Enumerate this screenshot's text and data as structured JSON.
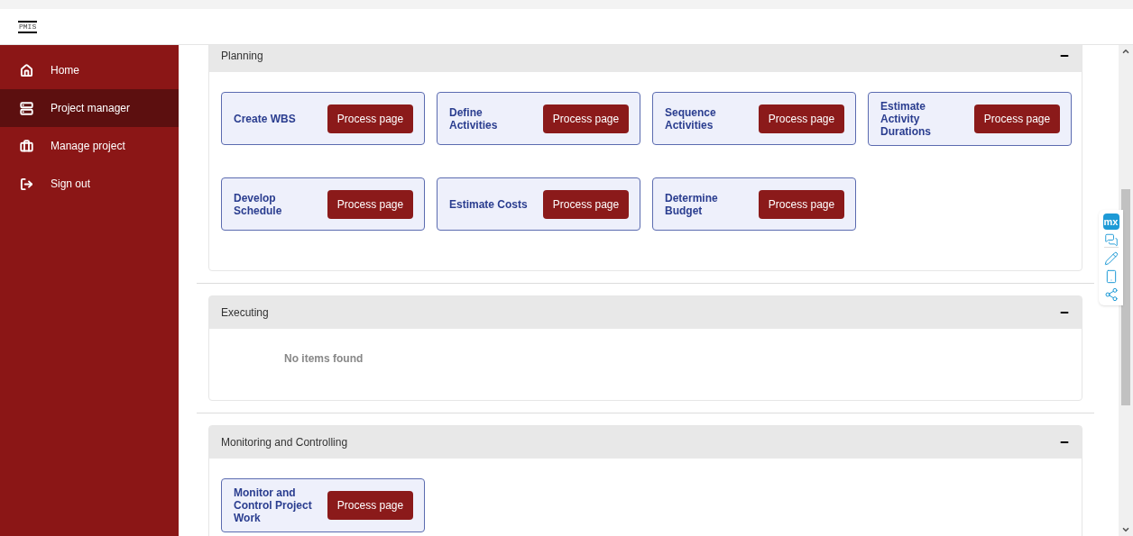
{
  "header": {
    "logo": "PMIS"
  },
  "sidebar": {
    "items": [
      {
        "label": "Home",
        "selected": false
      },
      {
        "label": "Project manager",
        "selected": true
      },
      {
        "label": "Manage project",
        "selected": false
      },
      {
        "label": "Sign out",
        "selected": false
      }
    ]
  },
  "sections": [
    {
      "title": "Planning",
      "expanded": true,
      "cards": [
        {
          "title": "Create WBS",
          "button": "Process page"
        },
        {
          "title": "Define Activities",
          "button": "Process page"
        },
        {
          "title": "Sequence Activities",
          "button": "Process page"
        },
        {
          "title": "Estimate Activity Durations",
          "button": "Process page"
        },
        {
          "title": "Develop Schedule",
          "button": "Process page"
        },
        {
          "title": "Estimate Costs",
          "button": "Process page"
        },
        {
          "title": "Determine Budget",
          "button": "Process page"
        }
      ]
    },
    {
      "title": "Executing",
      "expanded": true,
      "empty_text": "No items found"
    },
    {
      "title": "Monitoring and Controlling",
      "expanded": true,
      "cards": [
        {
          "title": "Monitor and Control Project Work",
          "button": "Process page"
        }
      ]
    }
  ],
  "side_toolbar": {
    "logo": "mx"
  }
}
